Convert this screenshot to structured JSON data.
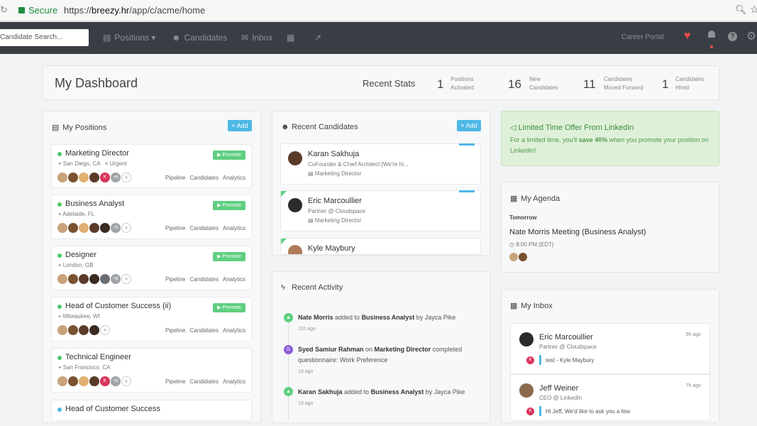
{
  "browser": {
    "secure_label": "Secure",
    "url_prefix": "https://",
    "url_host": "breezy.hr",
    "url_path": "/app/c/acme/home"
  },
  "nav": {
    "search_placeholder": "Candidate Search...",
    "positions": "Positions",
    "candidates": "Candidates",
    "inbox": "Inbox",
    "career_portal": "Career Portal"
  },
  "dashboard": {
    "title": "My Dashboard",
    "recent_stats": "Recent Stats",
    "stats": [
      {
        "n": "1",
        "l1": "Positions",
        "l2": "Activated"
      },
      {
        "n": "16",
        "l1": "New",
        "l2": "Candidates"
      },
      {
        "n": "11",
        "l1": "Candidates",
        "l2": "Moved Forward"
      },
      {
        "n": "1",
        "l1": "Candidates",
        "l2": "Hired"
      }
    ]
  },
  "positions": {
    "heading": "My Positions",
    "add": "+ Add",
    "promote": "Promote",
    "links": [
      "Pipeline",
      "Candidates",
      "Analytics"
    ],
    "items": [
      {
        "name": "Marketing Director",
        "loc": "San Diego, CA",
        "extra": "Urgent",
        "more": "+6"
      },
      {
        "name": "Business Analyst",
        "loc": "Adelaide, FL",
        "extra": "",
        "more": "+5"
      },
      {
        "name": "Designer",
        "loc": "London, GB",
        "extra": "",
        "more": "+6"
      },
      {
        "name": "Head of Customer Success (ii)",
        "loc": "Milwaukee, WI",
        "extra": "",
        "more": ""
      },
      {
        "name": "Technical Engineer",
        "loc": "San Francisco, CA",
        "extra": "",
        "more": "+6"
      },
      {
        "name": "Head of Customer Success",
        "loc": "",
        "extra": "",
        "more": ""
      }
    ]
  },
  "candidates": {
    "heading": "Recent Candidates",
    "add": "+ Add",
    "items": [
      {
        "name": "Karan Sakhuja",
        "sub": "CoFounder & Chief Architect [We're hi...",
        "job": "Marketing Director"
      },
      {
        "name": "Eric Marcoullier",
        "sub": "Partner @ Cloudspace",
        "job": "Marketing Director"
      },
      {
        "name": "Kyle Maybury",
        "sub": "",
        "job": ""
      }
    ]
  },
  "activity": {
    "heading": "Recent Activity",
    "items": [
      {
        "who": "Nate Morris",
        "mid": " added to ",
        "what": "Business Analyst",
        "tail": " by Jayca Pike",
        "tail2": "",
        "time": "11h ago"
      },
      {
        "who": "Syed Samiur Rahman",
        "mid": " on ",
        "what": "Marketing Director",
        "tail": " completed",
        "tail2": "questionnaire: Work Preference",
        "time": "1d ago"
      },
      {
        "who": "Karan Sakhuja",
        "mid": " added to ",
        "what": "Business Analyst",
        "tail": " by Jayca Pike",
        "tail2": "",
        "time": "1d ago"
      }
    ]
  },
  "offer": {
    "heading": "Limited Time Offer From LinkedIn",
    "pre": "For a limited time, you'll ",
    "bold": "save 40%",
    "post": " when you promote your position on LinkedIn!"
  },
  "agenda": {
    "heading": "My Agenda",
    "day": "Tomorrow",
    "event": "Nate Morris Meeting (Business Analyst)",
    "time": "8:00 PM (EDT)"
  },
  "inbox": {
    "heading": "My Inbox",
    "items": [
      {
        "name": "Eric Marcoullier",
        "sub": "Partner @ Cloudspace",
        "msg": "test  - Kyle Maybury",
        "time": "5h ago"
      },
      {
        "name": "Jeff Weiner",
        "sub": "CEO @ LinkedIn",
        "msg": "Hi Jeff, We'd like to ask you a few",
        "time": "7h ago"
      }
    ]
  },
  "colors": {
    "accent": "#4db8e5",
    "success": "#5fcf80",
    "nav": "#3a3e44",
    "heart": "#e84c4c"
  }
}
